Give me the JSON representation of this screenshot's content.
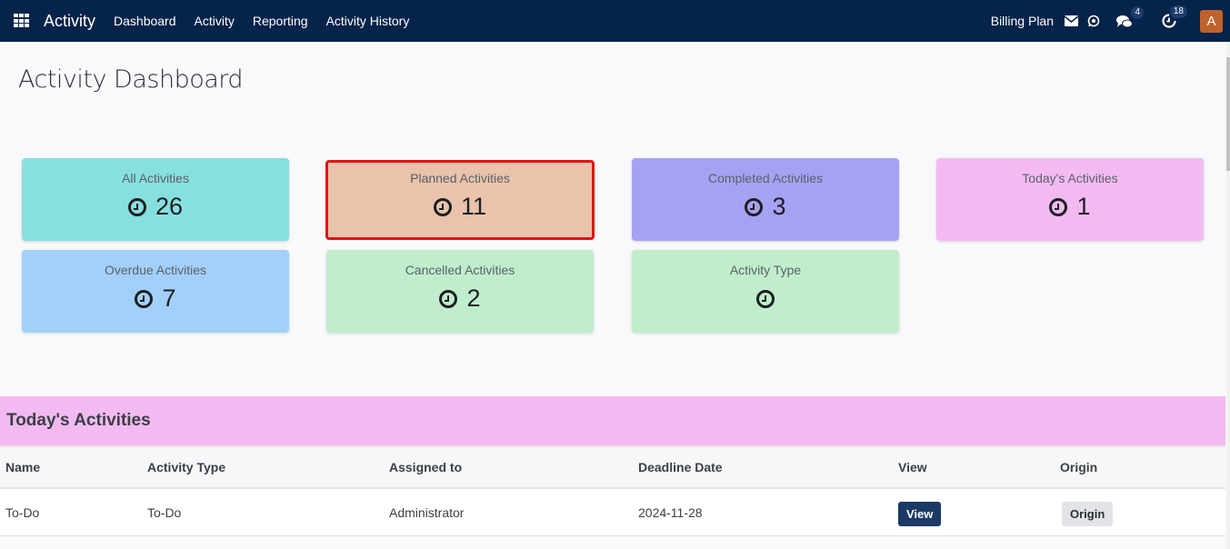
{
  "navbar": {
    "app_name": "Activity",
    "menu": [
      "Dashboard",
      "Activity",
      "Reporting",
      "Activity History"
    ],
    "billing_plan": "Billing Plan",
    "icons": [
      "envelope-icon",
      "whatsapp-icon",
      "chat-icon",
      "activity-clock-icon"
    ],
    "chat_badge": "4",
    "activity_badge": "18",
    "avatar_initial": "A",
    "brand_color": "#06234a",
    "avatar_color": "#c0622c"
  },
  "page": {
    "title": "Activity Dashboard"
  },
  "cards": [
    {
      "title": "All Activities",
      "value": "26",
      "color": "#87e0e0"
    },
    {
      "title": "Planned Activities",
      "value": "11",
      "color": "#e9c3ab",
      "selected": true
    },
    {
      "title": "Completed Activities",
      "value": "3",
      "color": "#a6a2f3"
    },
    {
      "title": "Today's Activities",
      "value": "1",
      "color": "#f3baf2"
    },
    {
      "title": "Overdue Activities",
      "value": "7",
      "color": "#a2d0fa"
    },
    {
      "title": "Cancelled Activities",
      "value": "2",
      "color": "#c0eecc"
    },
    {
      "title": "Activity Type",
      "value": "",
      "color": "#c0eecc"
    }
  ],
  "today": {
    "heading": "Today's Activities",
    "columns": [
      "Name",
      "Activity Type",
      "Assigned to",
      "Deadline Date",
      "View",
      "Origin"
    ],
    "rows": [
      {
        "name": "To-Do",
        "activity_type": "To-Do",
        "assigned_to": "Administrator",
        "deadline": "2024-11-28",
        "view_label": "View",
        "origin_label": "Origin"
      }
    ]
  }
}
